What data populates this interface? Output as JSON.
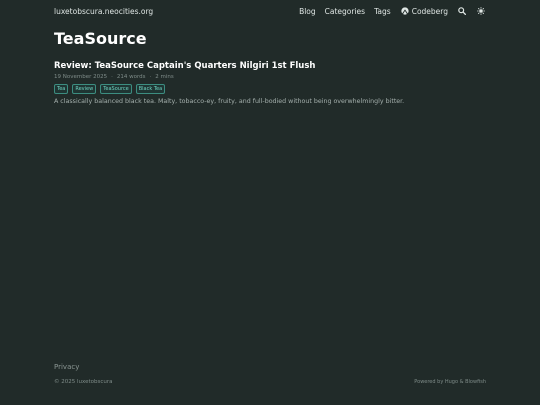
{
  "header": {
    "site_title": "luxetobscura.neocities.org",
    "nav": {
      "blog": "Blog",
      "categories": "Categories",
      "tags": "Tags",
      "codeberg": "Codeberg"
    },
    "icons": {
      "codeberg": "codeberg-icon",
      "search": "search-icon",
      "theme": "sun-icon"
    }
  },
  "main": {
    "title": "TeaSource",
    "article": {
      "title": "Review: TeaSource Captain's Quarters Nilgiri 1st Flush",
      "date": "19 November 2025",
      "words": "214 words",
      "read_time": "2 mins",
      "separator": "·",
      "tags": [
        "Tea",
        "Review",
        "TeaSource",
        "Black Tea"
      ],
      "summary": "A classically balanced black tea. Malty, tobacco-ey, fruity, and full-bodied without being overwhelmingly bitter."
    }
  },
  "footer": {
    "privacy": "Privacy",
    "copyright": "© 2025 luxetobscura",
    "powered_by": "Powered by Hugo & Blowfish"
  },
  "colors": {
    "background": "#212b29",
    "accent": "#6ed3c0",
    "text": "#dfe6e4"
  }
}
